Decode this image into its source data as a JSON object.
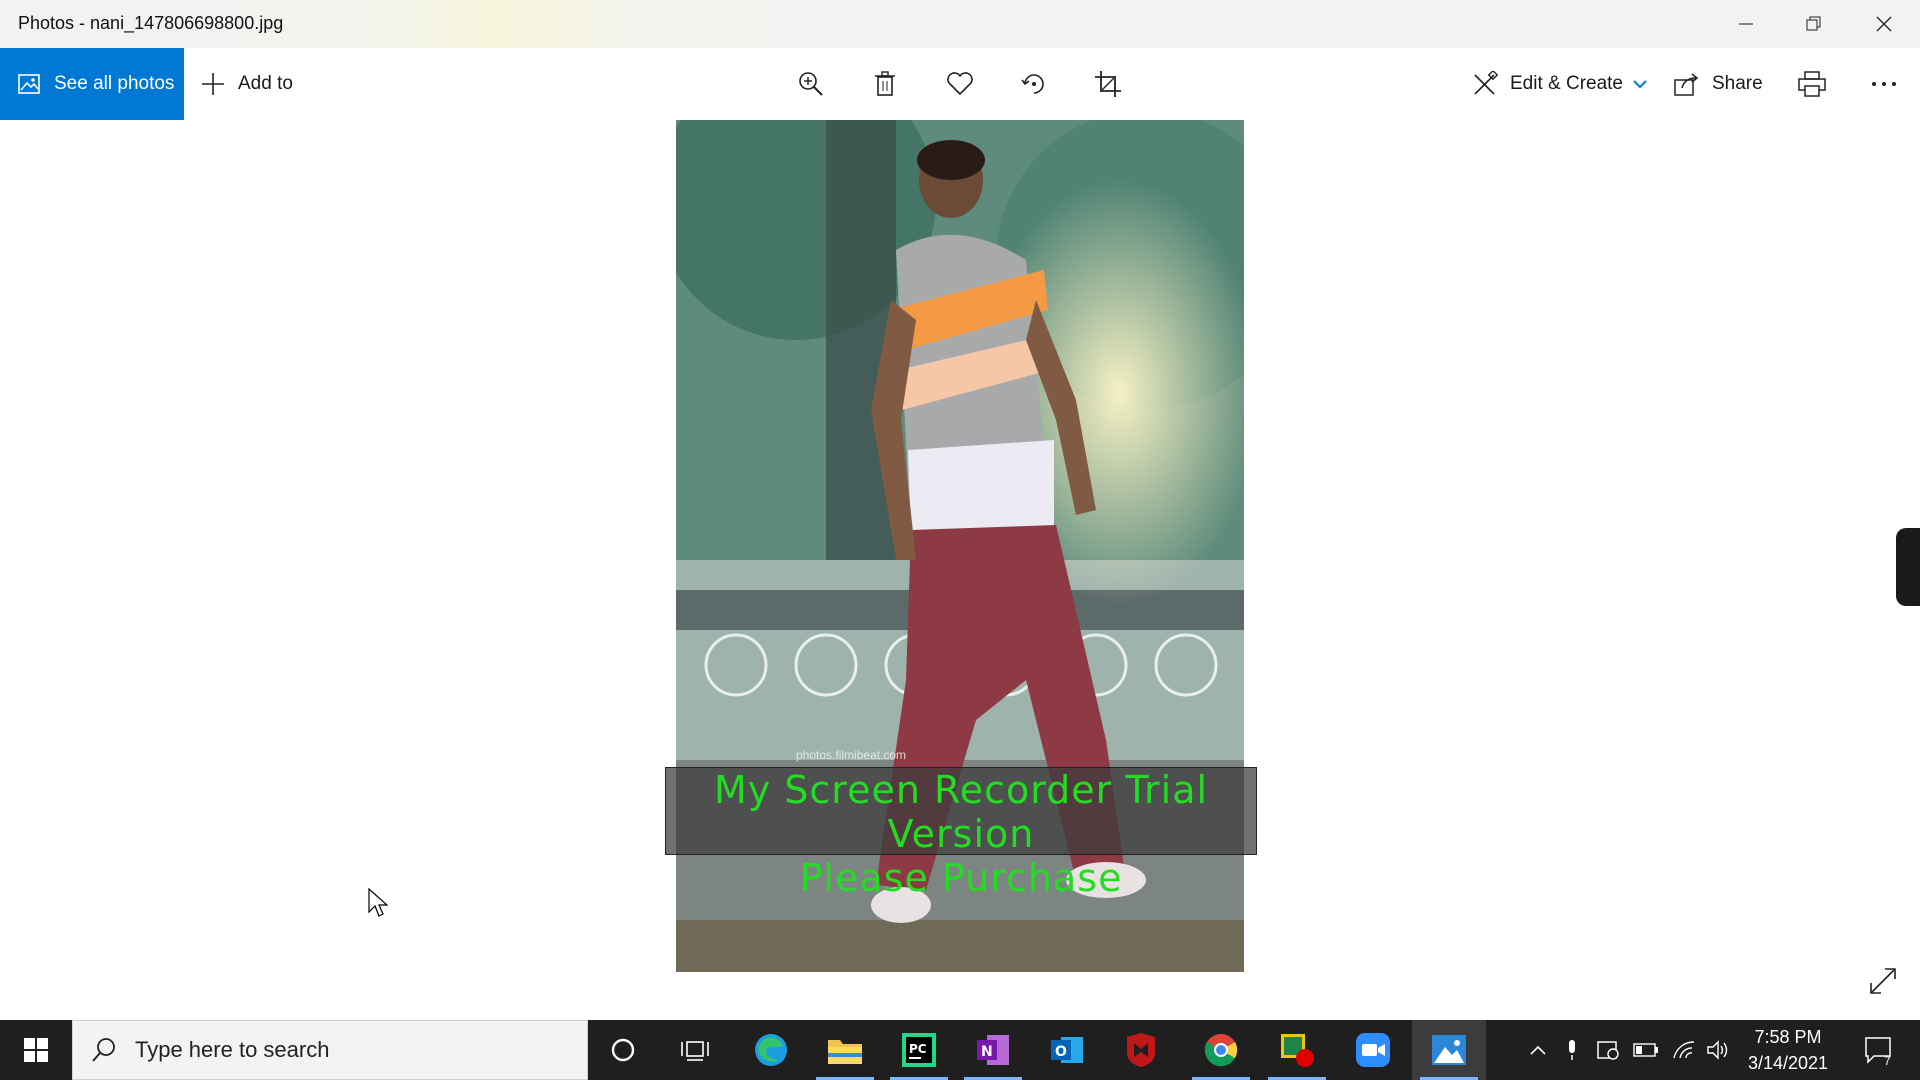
{
  "window": {
    "title": "Photos - nani_147806698800.jpg"
  },
  "toolbar": {
    "see_all_photos": "See all photos",
    "add_to": "Add to",
    "edit_create": "Edit & Create",
    "share": "Share",
    "icons": [
      "zoom-in-icon",
      "delete-icon",
      "favorite-icon",
      "rotate-icon",
      "crop-icon",
      "print-icon",
      "more-icon"
    ]
  },
  "photo": {
    "credit": "photos.filmibeat.com",
    "watermark_line1": "My Screen Recorder Trial Version",
    "watermark_line2": "Please Purchase"
  },
  "taskbar": {
    "search_placeholder": "Type here to search",
    "time": "7:58 PM",
    "date": "3/14/2021",
    "notification_count": "7",
    "apps": [
      "cortana",
      "task-view",
      "edge",
      "file-explorer",
      "pycharm",
      "onenote",
      "outlook",
      "mcafee",
      "chrome",
      "screen-recorder",
      "zoom",
      "photos"
    ]
  },
  "colors": {
    "accent": "#0078d4",
    "watermark_text": "#22dd22",
    "taskbar": "#1f1f1f"
  }
}
